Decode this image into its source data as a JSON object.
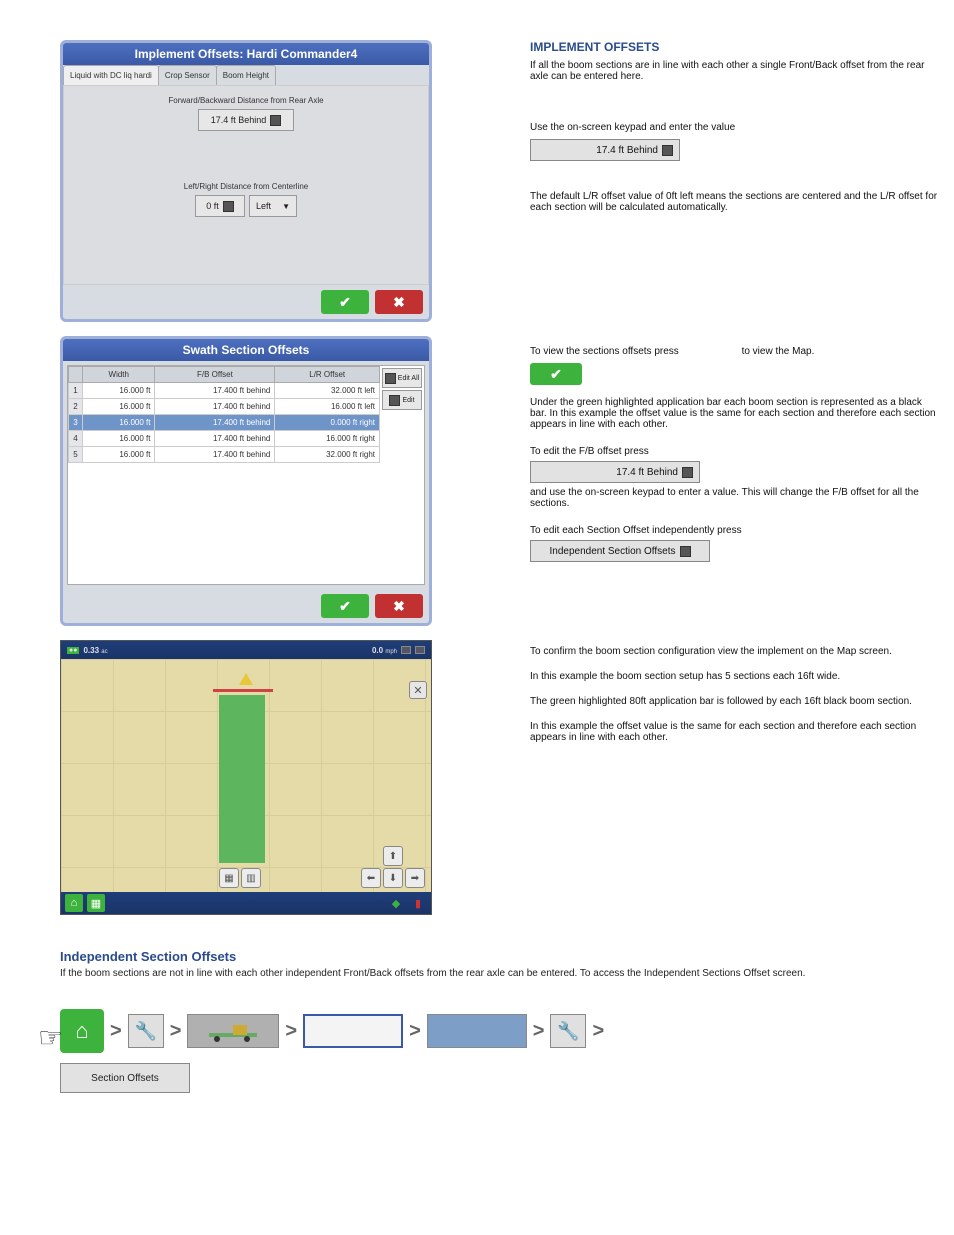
{
  "panel1": {
    "title": "Implement Offsets: Hardi Commander4",
    "tabs": [
      "Liquid with DC liq hardi",
      "Crop Sensor",
      "Boom Height"
    ],
    "fb_label": "Forward/Backward Distance from Rear Axle",
    "fb_value": "17.4 ft Behind",
    "lr_label": "Left/Right Distance from Centerline",
    "lr_value": "0 ft",
    "lr_dir": "Left"
  },
  "panel2": {
    "title": "Swath Section Offsets",
    "headers": [
      "",
      "Width",
      "F/B Offset",
      "L/R Offset"
    ],
    "rows": [
      {
        "n": "1",
        "w": "16.000 ft",
        "fb": "17.400 ft behind",
        "lr": "32.000 ft left",
        "sel": false
      },
      {
        "n": "2",
        "w": "16.000 ft",
        "fb": "17.400 ft behind",
        "lr": "16.000 ft left",
        "sel": false
      },
      {
        "n": "3",
        "w": "16.000 ft",
        "fb": "17.400 ft behind",
        "lr": "0.000 ft right",
        "sel": true
      },
      {
        "n": "4",
        "w": "16.000 ft",
        "fb": "17.400 ft behind",
        "lr": "16.000 ft right",
        "sel": false
      },
      {
        "n": "5",
        "w": "16.000 ft",
        "fb": "17.400 ft behind",
        "lr": "32.000 ft right",
        "sel": false
      }
    ],
    "editAll": "Edit All",
    "edit": "Edit"
  },
  "panel3": {
    "area": "0.33",
    "area_unit": "ac",
    "speed": "0.0",
    "speed_unit": "mph"
  },
  "rtext": {
    "main_offsets_title": "IMPLEMENT OFFSETS",
    "main_offsets_body": "If all the boom sections are in line with each other a single Front/Back offset from the rear axle can be entered here.",
    "use_keypad": "Use the on-screen keypad and enter the value",
    "offset_field_label": "17.4 ft Behind",
    "default_para": "The default L/R offset value of 0ft left means the sections are centered and the L/R offset for each section will be calculated automatically.",
    "view_map_prefix": "To view the sections offsets press",
    "view_map_suffix": "to view the Map.",
    "under_green": "Under the green highlighted application bar each boom section is represented as a black bar. In this example the offset value is the same for each section and therefore each section appears in line with each other.",
    "edit_fb_prefix": "To edit the F/B offset press",
    "edit_fb_body": "and use the on-screen keypad to enter a value. This will change the F/B offset for all the sections.",
    "independent_prefix": "To edit each Section Offset independently press",
    "independent_label": "Independent Section Offsets",
    "offset_field_label2": "17.4 ft Behind",
    "map_para1": "To confirm the boom section configuration view the implement on the Map screen.",
    "map_para2": "In this example the boom section setup has 5 sections each 16ft wide.",
    "map_para3": "The green highlighted 80ft application bar is followed by each 16ft black boom section.",
    "map_para4": "In this example the offset value is the same for each section and therefore each section appears in line with each other."
  },
  "bottom": {
    "heading": "Independent Section Offsets",
    "para": "If the boom sections are not in line with each other independent Front/Back offsets from the rear axle can be entered. To access the Independent Sections Offset screen.",
    "crumb_labels": {
      "configuration": "Configuration",
      "controller": "Controller",
      "offsets": "Section Offsets"
    }
  }
}
